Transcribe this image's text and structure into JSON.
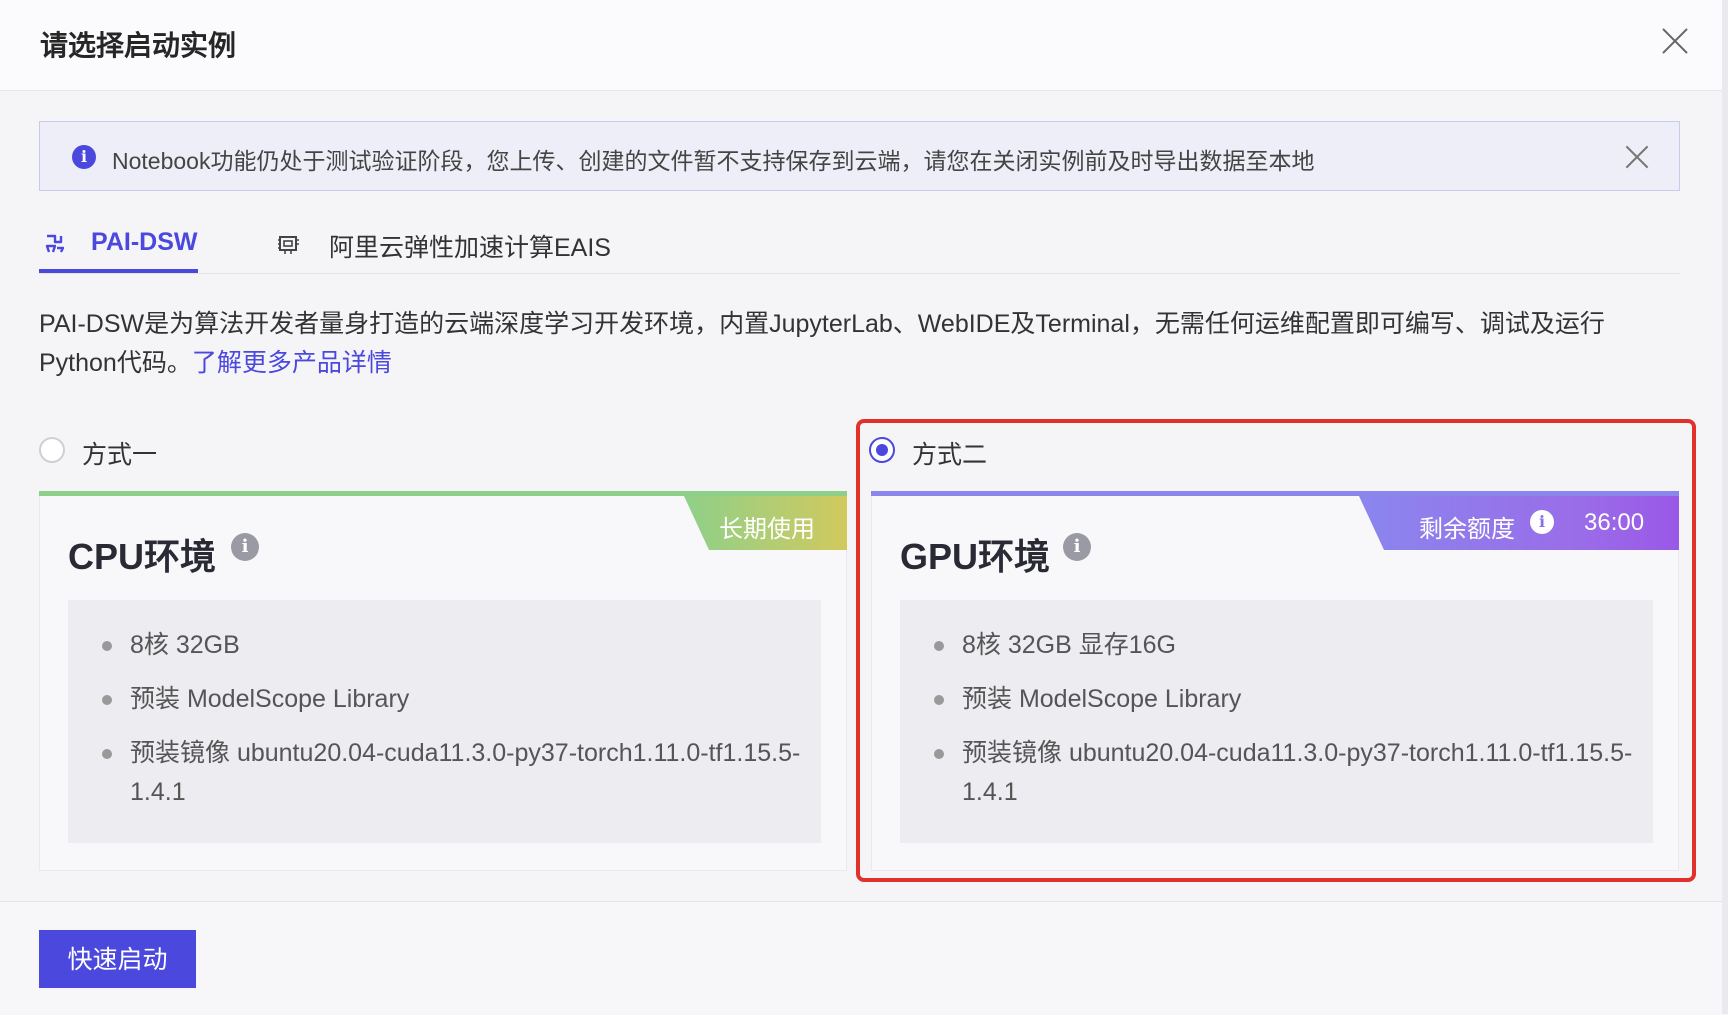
{
  "dialog": {
    "title": "请选择启动实例"
  },
  "alert": {
    "text": "Notebook功能仍处于测试验证阶段，您上传、创建的文件暂不支持保存到云端，请您在关闭实例前及时导出数据至本地"
  },
  "tabs": [
    {
      "label": "PAI-DSW",
      "active": true,
      "icon": "pai-dsw-icon"
    },
    {
      "label": "阿里云弹性加速计算EAIS",
      "active": false,
      "icon": "eais-icon"
    }
  ],
  "description": {
    "text": "PAI-DSW是为算法开发者量身打造的云端深度学习开发环境，内置JupyterLab、WebIDE及Terminal，无需任何运维配置即可编写、调试及运行Python代码。",
    "link": "了解更多产品详情"
  },
  "options": [
    {
      "label": "方式一",
      "selected": false,
      "card": {
        "title": "CPU环境",
        "badge": "长期使用",
        "specs": [
          "8核 32GB",
          "预装 ModelScope Library",
          "预装镜像 ubuntu20.04-cuda11.3.0-py37-torch1.11.0-tf1.15.5-1.4.1"
        ]
      }
    },
    {
      "label": "方式二",
      "selected": true,
      "card": {
        "title": "GPU环境",
        "badge_label": "剩余额度",
        "badge_value": "36:00",
        "specs": [
          "8核 32GB 显存16G",
          "预装 ModelScope Library",
          "预装镜像 ubuntu20.04-cuda11.3.0-py37-torch1.11.0-tf1.15.5-1.4.1"
        ]
      }
    }
  ],
  "footer": {
    "launch_label": "快速启动"
  },
  "colors": {
    "accent": "#4b48dd",
    "highlight": "#e0312b",
    "cpu_bar": "#8ed08a",
    "gpu_bar": "#8b86ee"
  }
}
